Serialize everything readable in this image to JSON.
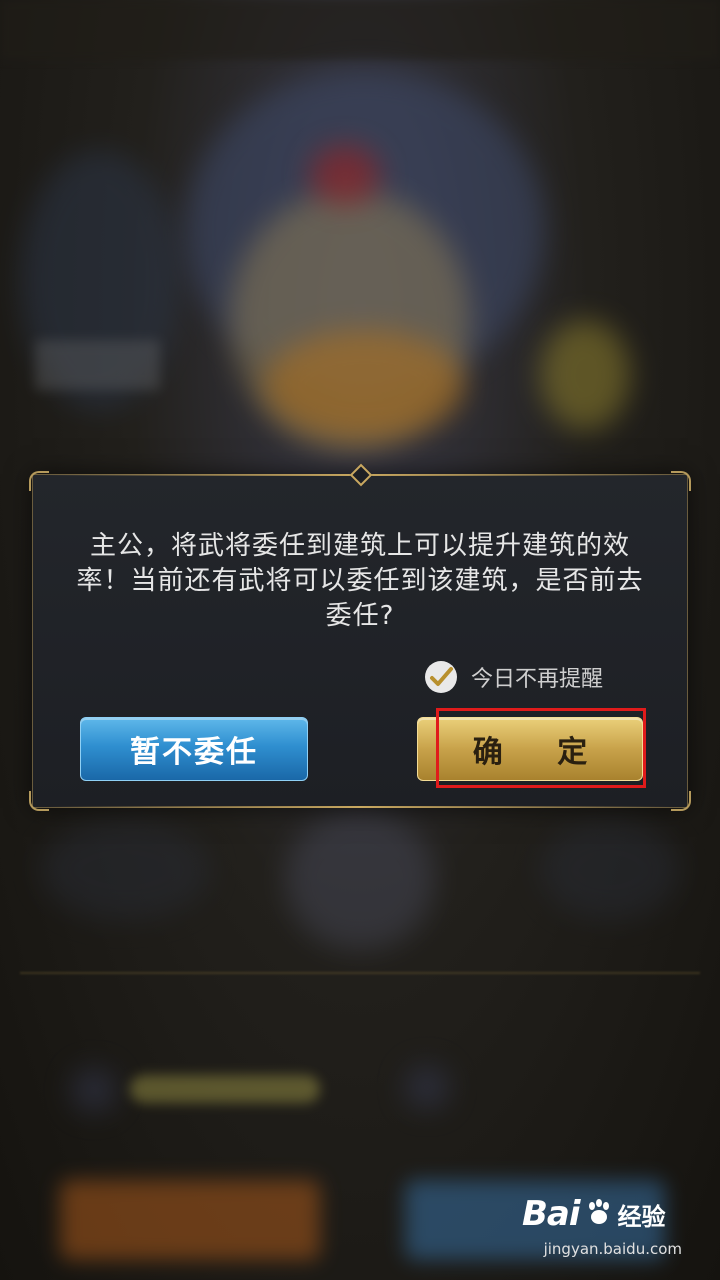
{
  "dialog": {
    "message": "主公，将武将委任到建筑上可以提升建筑的效率！当前还有武将可以委任到该建筑，是否前去委任?",
    "remind_label": "今日不再提醒",
    "remind_checked": true,
    "cancel_label": "暂不委任",
    "confirm_label": "确 定"
  },
  "watermark": {
    "brand": "Bai",
    "suffix": "经验",
    "url": "jingyan.baidu.com"
  },
  "colors": {
    "highlight": "#e01b1b",
    "confirm_gold": "#c8a24a",
    "cancel_blue": "#2f8fd0",
    "dialog_bg": "#1f2226"
  },
  "icons": [
    "checkmark-icon",
    "baidu-paw-icon"
  ]
}
